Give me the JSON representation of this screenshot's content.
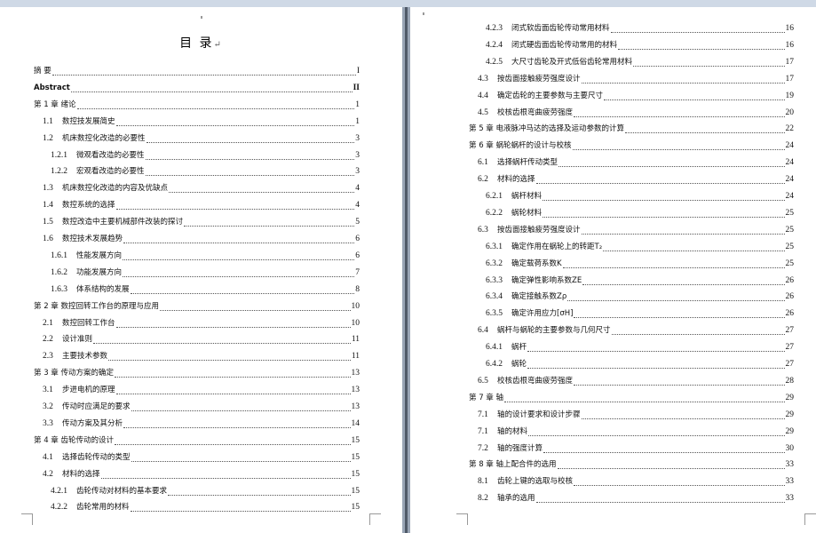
{
  "document": {
    "toc_title": "目    录",
    "paragraph_mark": "↵",
    "page1_entries": [
      {
        "level": 0,
        "num": "",
        "text": "摘    要",
        "page": "I",
        "bold": false
      },
      {
        "level": 0,
        "num": "",
        "text": "Abstract",
        "page": "II",
        "bold": true
      },
      {
        "level": 0,
        "num": "",
        "text": "第 1 章   绪论",
        "page": "1",
        "bold": false
      },
      {
        "level": 1,
        "num": "1.1",
        "text": "数控技发展简史",
        "page": "1",
        "bold": false
      },
      {
        "level": 1,
        "num": "1.2",
        "text": "机床数控化改造的必要性",
        "page": "3",
        "bold": false
      },
      {
        "level": 2,
        "num": "1.2.1",
        "text": "微观看改造的必要性",
        "page": "3",
        "bold": false
      },
      {
        "level": 2,
        "num": "1.2.2",
        "text": "宏观看改造的必要性",
        "page": "3",
        "bold": false
      },
      {
        "level": 1,
        "num": "1.3",
        "text": "机床数控化改造的内容及优缺点",
        "page": "4",
        "bold": false
      },
      {
        "level": 1,
        "num": "1.4",
        "text": "数控系统的选择",
        "page": "4",
        "bold": false
      },
      {
        "level": 1,
        "num": "1.5",
        "text": "数控改造中主要机械部件改装的探讨",
        "page": "5",
        "bold": false
      },
      {
        "level": 1,
        "num": "1.6",
        "text": "数控技术发展趋势",
        "page": "6",
        "bold": false
      },
      {
        "level": 2,
        "num": "1.6.1",
        "text": "性能发展方向",
        "page": "6",
        "bold": false
      },
      {
        "level": 2,
        "num": "1.6.2",
        "text": "功能发展方向",
        "page": "7",
        "bold": false
      },
      {
        "level": 2,
        "num": "1.6.3",
        "text": "体系结构的发展",
        "page": "8",
        "bold": false
      },
      {
        "level": 0,
        "num": "",
        "text": "第 2 章   数控回转工作台的原理与应用",
        "page": "10",
        "bold": false
      },
      {
        "level": 1,
        "num": "2.1",
        "text": "数控回转工作台",
        "page": "10",
        "bold": false
      },
      {
        "level": 1,
        "num": "2.2",
        "text": "设计准则",
        "page": "11",
        "bold": false
      },
      {
        "level": 1,
        "num": "2.3",
        "text": "主要技术参数",
        "page": "11",
        "bold": false
      },
      {
        "level": 0,
        "num": "",
        "text": "第 3 章   传动方案的确定",
        "page": "13",
        "bold": false
      },
      {
        "level": 1,
        "num": "3.1",
        "text": "步进电机的原理",
        "page": "13",
        "bold": false
      },
      {
        "level": 1,
        "num": "3.2",
        "text": "传动时应满足的要求",
        "page": "13",
        "bold": false
      },
      {
        "level": 1,
        "num": "3.3",
        "text": "传动方案及其分析",
        "page": "14",
        "bold": false
      },
      {
        "level": 0,
        "num": "",
        "text": "第 4 章   齿轮传动的设计",
        "page": "15",
        "bold": false
      },
      {
        "level": 1,
        "num": "4.1",
        "text": "选择齿轮传动的类型",
        "page": "15",
        "bold": false
      },
      {
        "level": 1,
        "num": "4.2",
        "text": "材料的选择",
        "page": "15",
        "bold": false
      },
      {
        "level": 2,
        "num": "4.2.1",
        "text": "齿轮传动对材料的基本要求",
        "page": "15",
        "bold": false
      },
      {
        "level": 2,
        "num": "4.2.2",
        "text": "齿轮常用的材料",
        "page": "15",
        "bold": false
      }
    ],
    "page2_entries": [
      {
        "level": 2,
        "num": "4.2.3",
        "text": "闭式软齿面齿轮传动常用材料",
        "page": "16",
        "bold": false
      },
      {
        "level": 2,
        "num": "4.2.4",
        "text": "闭式硬齿面齿轮传动常用的材料",
        "page": "16",
        "bold": false
      },
      {
        "level": 2,
        "num": "4.2.5",
        "text": "大尺寸齿轮及开式低俗齿轮常用材料",
        "page": "17",
        "bold": false
      },
      {
        "level": 1,
        "num": "4.3",
        "text": "按齿面接触疲劳强度设计",
        "page": "17",
        "bold": false
      },
      {
        "level": 1,
        "num": "4.4",
        "text": "确定齿轮的主要参数与主要尺寸",
        "page": "19",
        "bold": false
      },
      {
        "level": 1,
        "num": "4.5",
        "text": "校核齿根弯曲疲劳强度",
        "page": "20",
        "bold": false
      },
      {
        "level": 0,
        "num": "",
        "text": "第 5 章   电液脉冲马达的选择及运动参数的计算",
        "page": "22",
        "bold": false
      },
      {
        "level": 0,
        "num": "",
        "text": "第 6 章   蜗轮蜗杆的设计与校核",
        "page": "24",
        "bold": false
      },
      {
        "level": 1,
        "num": "6.1",
        "text": "选择蜗杆传动类型",
        "page": "24",
        "bold": false
      },
      {
        "level": 1,
        "num": "6.2",
        "text": "材料的选择",
        "page": "24",
        "bold": false
      },
      {
        "level": 2,
        "num": "6.2.1",
        "text": "蜗杆材料",
        "page": "24",
        "bold": false
      },
      {
        "level": 2,
        "num": "6.2.2",
        "text": "蜗轮材料",
        "page": "25",
        "bold": false
      },
      {
        "level": 1,
        "num": "6.3",
        "text": "按齿面接触疲劳强度设计",
        "page": "25",
        "bold": false
      },
      {
        "level": 2,
        "num": "6.3.1",
        "text": "确定作用在蜗轮上的转距T₂",
        "page": "25",
        "bold": false
      },
      {
        "level": 2,
        "num": "6.3.2",
        "text": "确定载荷系数K",
        "page": "25",
        "bold": false
      },
      {
        "level": 2,
        "num": "6.3.3",
        "text": "确定弹性影响系数ZE",
        "page": "26",
        "bold": false
      },
      {
        "level": 2,
        "num": "6.3.4",
        "text": "确定接触系数Zρ",
        "page": "26",
        "bold": false
      },
      {
        "level": 2,
        "num": "6.3.5",
        "text": "确定许用应力[σH]",
        "page": "26",
        "bold": false
      },
      {
        "level": 1,
        "num": "6.4",
        "text": "蜗杆与蜗轮的主要参数与几何尺寸",
        "page": "27",
        "bold": false
      },
      {
        "level": 2,
        "num": "6.4.1",
        "text": "蜗杆",
        "page": "27",
        "bold": false
      },
      {
        "level": 2,
        "num": "6.4.2",
        "text": "蜗轮",
        "page": "27",
        "bold": false
      },
      {
        "level": 1,
        "num": "6.5",
        "text": "校核齿根弯曲疲劳强度",
        "page": "28",
        "bold": false
      },
      {
        "level": 0,
        "num": "",
        "text": "第 7 章   轴",
        "page": "29",
        "bold": false
      },
      {
        "level": 1,
        "num": "7.1",
        "text": "轴的设计要求和设计步骤",
        "page": "29",
        "bold": false
      },
      {
        "level": 1,
        "num": "7.1",
        "text": "轴的材料",
        "page": "29",
        "bold": false
      },
      {
        "level": 1,
        "num": "7.2",
        "text": "轴的强度计算",
        "page": "30",
        "bold": false
      },
      {
        "level": 0,
        "num": "",
        "text": "第 8 章   轴上配合件的选用",
        "page": "33",
        "bold": false
      },
      {
        "level": 1,
        "num": "8.1",
        "text": "齿轮上键的选取与校核",
        "page": "33",
        "bold": false
      },
      {
        "level": 1,
        "num": "8.2",
        "text": "轴承的选用",
        "page": "33",
        "bold": false
      }
    ]
  }
}
